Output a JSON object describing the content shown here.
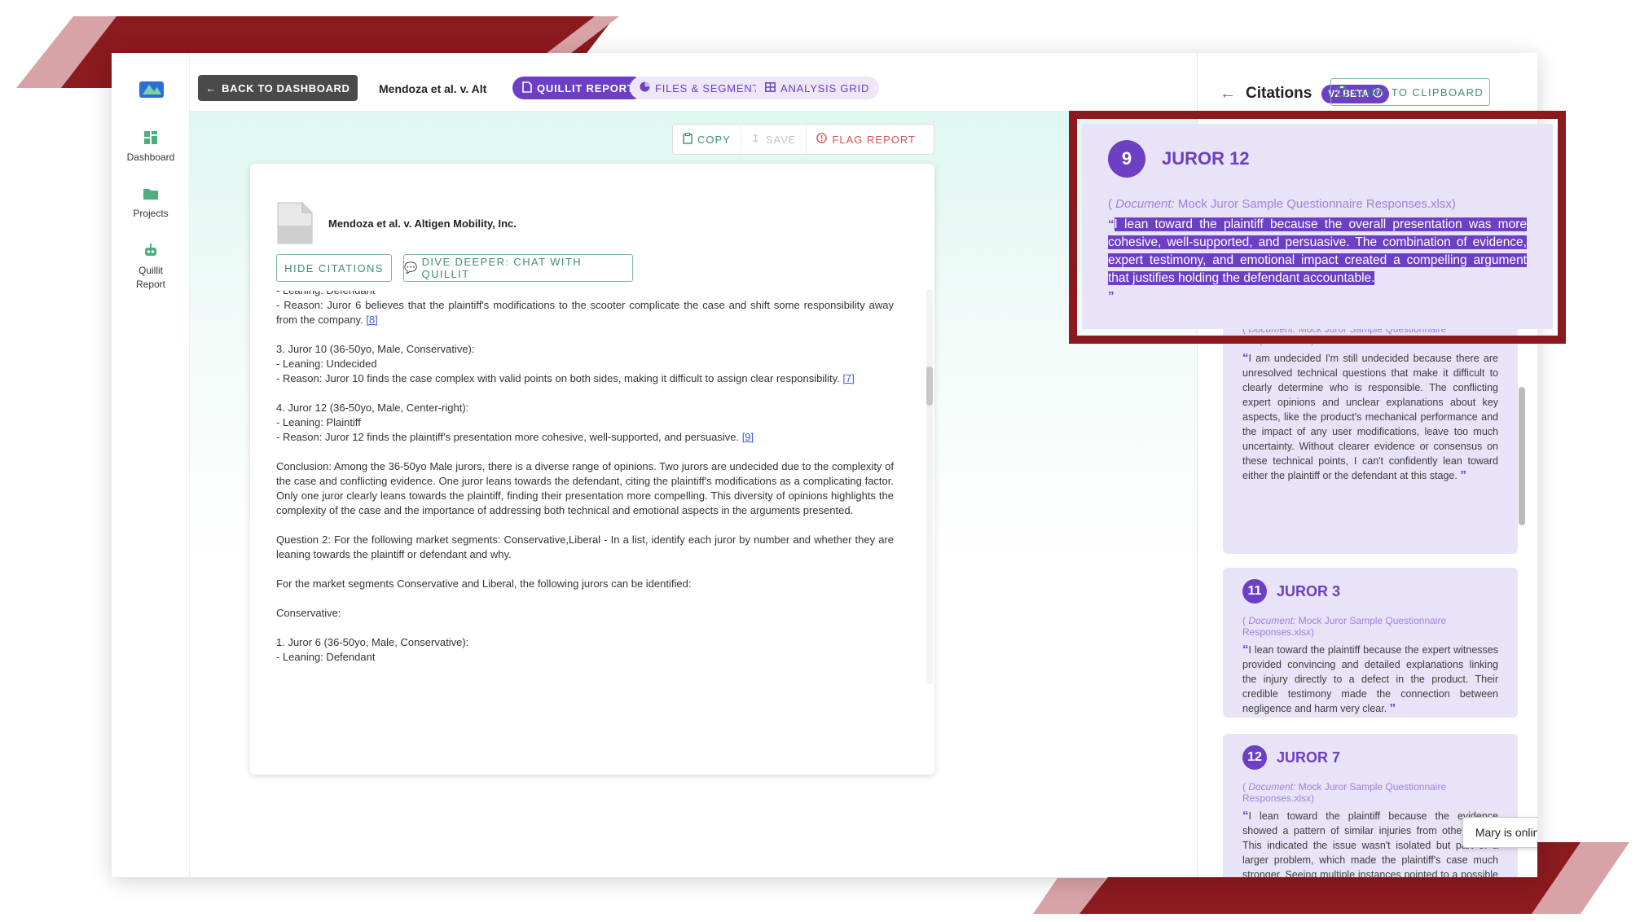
{
  "app": {
    "back_label": "BACK TO DASHBOARD",
    "case_title_short": "Mendoza et al. v. Alt",
    "tabs": [
      {
        "label": "QUILLIT REPORT",
        "active": true
      },
      {
        "label": "FILES & SEGMENTS",
        "active": false
      },
      {
        "label": "ANALYSIS GRID",
        "active": false
      }
    ]
  },
  "sidebar": {
    "items": [
      {
        "label": "Dashboard",
        "icon": "dashboard-icon"
      },
      {
        "label": "Projects",
        "icon": "folder-icon"
      },
      {
        "label": "Quillit Report",
        "icon": "robot-icon"
      }
    ]
  },
  "toolbar": {
    "copy_label": "COPY",
    "save_label": "SAVE",
    "flag_label": "FLAG REPORT"
  },
  "report": {
    "doc_title": "Mendoza et al. v. Altigen Mobility, Inc.",
    "hide_citations_label": "HIDE CITATIONS",
    "dive_deeper_label": "DIVE DEEPER: CHAT WITH QUILLIT",
    "cut_line": "- Leaning: Defendant",
    "p1_text": "- Reason: Juror 6 believes that the plaintiff's modifications to the scooter complicate the case and shift some responsibility away from the company.",
    "p1_cite": "[8]",
    "j10_title": "3. Juror 10 (36-50yo, Male, Conservative):",
    "j10_leaning": "- Leaning: Undecided",
    "j10_reason": "- Reason: Juror 10 finds the case complex with valid points on both sides, making it difficult to assign clear responsibility.",
    "j10_cite": "[7]",
    "j12_title": "4. Juror 12 (36-50yo, Male, Center-right):",
    "j12_leaning": "- Leaning: Plaintiff",
    "j12_reason": "- Reason: Juror 12 finds the plaintiff's presentation more cohesive, well-supported, and persuasive.",
    "j12_cite": "[9]",
    "conclusion": "Conclusion: Among the 36-50yo Male jurors, there is a diverse range of opinions. Two jurors are undecided due to the complexity of the case and conflicting evidence. One juror leans towards the defendant, citing the plaintiff's modifications as a complicating factor. Only one juror clearly leans towards the plaintiff, finding their presentation more compelling. This diversity of opinions highlights the complexity of the case and the importance of addressing both technical and emotional aspects in the arguments presented.",
    "question2": "Question 2: For the following market segments: Conservative,Liberal - In a list, identify each juror by number and whether they are leaning towards the plaintiff or defendant and why.",
    "segments_intro": "For the market segments Conservative and Liberal, the following jurors can be identified:",
    "conservative_heading": "Conservative:",
    "j6_title": "1. Juror 6 (36-50yo, Male, Conservative):",
    "j6_leaning": "- Leaning: Defendant"
  },
  "citations": {
    "title": "Citations",
    "beta_label": "V2 BETA",
    "copy_clipboard_label": "COPY TO CLIPBOARD",
    "doc_prefix": "Document:",
    "doc_name": "Mock Juror Sample Questionnaire Responses.xlsx",
    "open_quote": "“",
    "close_quote": "”",
    "highlighted": {
      "number": "9",
      "name": "JUROR 12",
      "quote": "I lean toward the plaintiff because the overall presentation was more cohesive, well-supported, and persuasive. The combination of evidence, expert testimony, and emotional impact created a compelling argument that justifies holding the defendant accountable."
    },
    "cards": [
      {
        "number": "",
        "name": "",
        "quote": "I am undecided I'm still undecided because there are unresolved technical questions that make it difficult to clearly determine who is responsible. The conflicting expert opinions and unclear explanations about key aspects, like the product's mechanical performance and the impact of any user modifications, leave too much uncertainty. Without clearer evidence or consensus on these technical points, I can't confidently lean toward either the plaintiff or the defendant at this stage."
      },
      {
        "number": "11",
        "name": "JUROR 3",
        "quote": "I lean toward the plaintiff because the expert witnesses provided convincing and detailed explanations linking the injury directly to a defect in the product. Their credible testimony made the connection between negligence and harm very clear."
      },
      {
        "number": "12",
        "name": "JUROR 7",
        "quote": "I lean toward the plaintiff because the evidence showed a pattern of similar injuries from other users. This indicated the issue wasn't isolated but part of a larger problem, which made the plaintiff's case much stronger. Seeing multiple instances pointed to a possible defect or negligence, which added significant weight to their argument."
      }
    ]
  },
  "presence": {
    "label": "Mary is online"
  },
  "colors": {
    "accent_purple": "#6c3fc4",
    "highlight_frame": "#8b1a1f",
    "outline_green": "#3f8f6c",
    "flag_red": "#d9534f"
  }
}
